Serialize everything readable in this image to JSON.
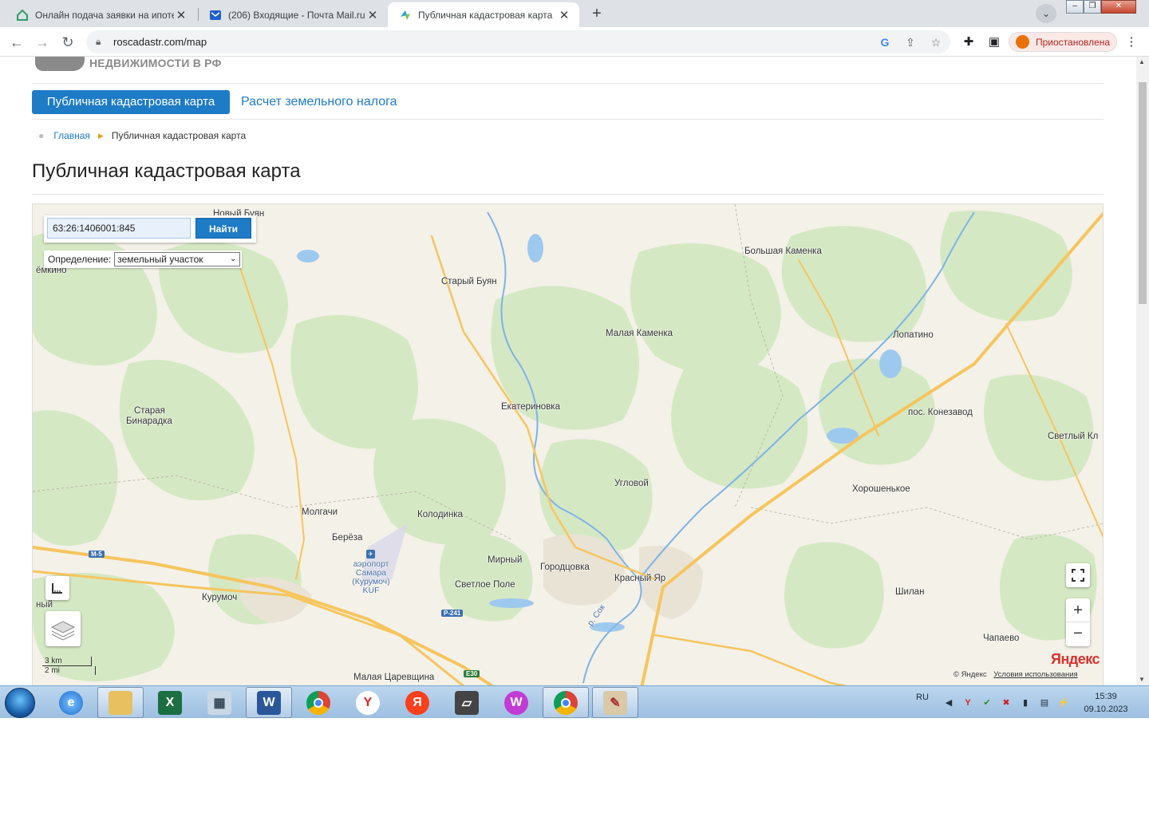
{
  "browser": {
    "tabs": [
      {
        "title": "Онлайн подача заявки на ипоте",
        "active": false
      },
      {
        "title": "(206) Входящие - Почта Mail.ru",
        "active": false
      },
      {
        "title": "Публичная кадастровая карта",
        "active": true
      }
    ],
    "close_glyph": "✕",
    "new_tab_glyph": "+",
    "url": "roscadastr.com/map",
    "profile_label": "Приостановлена",
    "window_controls": [
      "–",
      "❐",
      "✕"
    ]
  },
  "site": {
    "header_text": "НЕДВИЖИМОСТИ В РФ",
    "nav": {
      "active_tab": "Публичная кадастровая карта",
      "link_tab": "Расчет земельного налога"
    },
    "breadcrumb": {
      "home": "Главная",
      "current": "Публичная кадастровая карта"
    },
    "page_title": "Публичная кадастровая карта"
  },
  "map": {
    "search_value": "63:26:1406001:845",
    "search_button": "Найти",
    "definition_label": "Определение:",
    "definition_value": "земельный участок",
    "places": [
      "Новый Буян",
      "ёмкино",
      "Старый Буян",
      "Большая Каменка",
      "Малая Каменка",
      "Лопатино",
      "Старая",
      "Бинарадка",
      "Екатериновка",
      "пос. Конезавод",
      "Светлый Кл",
      "Угловой",
      "Хорошенькое",
      "Молгачи",
      "Колодинка",
      "Берёза",
      "Мирный",
      "Городцовка",
      "Красный Яр",
      "Светлое Поле",
      "Курумоч",
      "ный",
      "Шилан",
      "Чапаево",
      "Малая Царевщина"
    ],
    "airport_lines": [
      "аэропорт",
      "Самара",
      "(Курумоч)",
      "KUF"
    ],
    "river_label": "р. Сок",
    "road_signs": [
      "М-5",
      "Р-241",
      "E30"
    ],
    "scale": {
      "km": "3 km",
      "mi": "2 mi"
    },
    "copyright": "© Яндекс",
    "terms": "Условия использования",
    "yandex_logo": "Яндекс",
    "zoom_in": "+",
    "zoom_out": "−"
  },
  "taskbar": {
    "apps": [
      "explorer-ie",
      "file-manager",
      "excel",
      "calculator",
      "word",
      "chrome",
      "yandex-browser",
      "yandex",
      "scanner",
      "wps",
      "chrome-active",
      "paint"
    ],
    "lang": "RU",
    "time": "15:39",
    "date": "09.10.2023"
  },
  "colors": {
    "accent": "#1e7bc6",
    "forest": "#d5e8c4",
    "field": "#f4f1e8",
    "road": "#f6c55e",
    "water": "#9ec9ef"
  }
}
